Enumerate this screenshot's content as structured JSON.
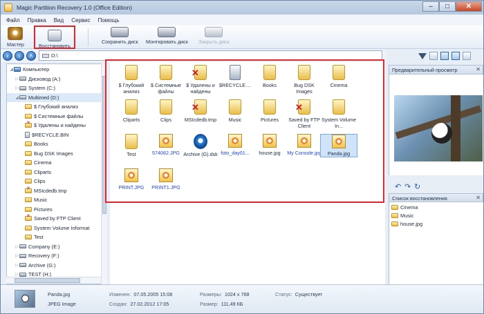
{
  "window": {
    "title": "Magic Partition Recovery 1.0 (Office Edition)"
  },
  "menu": [
    "Файл",
    "Правка",
    "Вид",
    "Сервис",
    "Помощь"
  ],
  "toolbar": {
    "master": "Мастер",
    "restore": "Восстановить",
    "save_disk": "Сохранить диск",
    "mount_disk": "Монтировать диск",
    "close_disk": "Закрыть диск"
  },
  "address": {
    "value": "D:\\"
  },
  "tree": [
    {
      "label": "Компьютер",
      "icon": "computer-icon",
      "depth": 0,
      "expanded": true
    },
    {
      "label": "Дисковод (A:)",
      "icon": "drive-icon",
      "depth": 1
    },
    {
      "label": "System (C:)",
      "icon": "drive-icon",
      "depth": 1
    },
    {
      "label": "Multimed (D:)",
      "icon": "drive-icon",
      "depth": 1,
      "selected": true,
      "expanded": true
    },
    {
      "label": "$ Глубокий анализ",
      "icon": "folder-icon",
      "depth": 2
    },
    {
      "label": "$ Системные файлы",
      "icon": "folder-icon",
      "depth": 2
    },
    {
      "label": "$ Удалены и найдены",
      "icon": "deleted-folder-icon",
      "depth": 2
    },
    {
      "label": "$RECYCLE.BIN",
      "icon": "recycle-bin-icon",
      "depth": 2
    },
    {
      "label": "Books",
      "icon": "folder-icon",
      "depth": 2
    },
    {
      "label": "Bug DSK Images",
      "icon": "folder-icon",
      "depth": 2
    },
    {
      "label": "Cinema",
      "icon": "folder-icon",
      "depth": 2
    },
    {
      "label": "Cliparts",
      "icon": "folder-icon",
      "depth": 2
    },
    {
      "label": "Clips",
      "icon": "folder-icon",
      "depth": 2
    },
    {
      "label": "MSIcdedb.tmp",
      "icon": "deleted-folder-icon",
      "depth": 2
    },
    {
      "label": "Music",
      "icon": "folder-icon",
      "depth": 2
    },
    {
      "label": "Pictures",
      "icon": "folder-icon",
      "depth": 2
    },
    {
      "label": "Saved by FTP Client",
      "icon": "deleted-folder-icon",
      "depth": 2
    },
    {
      "label": "System Volume Informat",
      "icon": "folder-icon",
      "depth": 2
    },
    {
      "label": "Test",
      "icon": "folder-icon",
      "depth": 2
    },
    {
      "label": "Company (E:)",
      "icon": "drive-icon",
      "depth": 1
    },
    {
      "label": "Recovery (F:)",
      "icon": "drive-icon",
      "depth": 1
    },
    {
      "label": "Archive (G:)",
      "icon": "drive-icon",
      "depth": 1
    },
    {
      "label": "TEST (H:)",
      "icon": "drive-icon",
      "depth": 1
    }
  ],
  "files": [
    {
      "name": "$ Глубокий анализ",
      "icon": "folder-icon"
    },
    {
      "name": "$ Системные файлы",
      "icon": "folder-icon"
    },
    {
      "name": "$ Удалены и найдены",
      "icon": "deleted-folder-icon"
    },
    {
      "name": "$RECYCLE....",
      "icon": "recycle-bin-icon"
    },
    {
      "name": "Books",
      "icon": "folder-icon"
    },
    {
      "name": "Bug DSK Images",
      "icon": "folder-icon"
    },
    {
      "name": "Cinema",
      "icon": "folder-icon"
    },
    {
      "name": "Cliparts",
      "icon": "folder-icon"
    },
    {
      "name": "Clips",
      "icon": "folder-icon"
    },
    {
      "name": "MSIcdedb.tmp",
      "icon": "deleted-folder-icon"
    },
    {
      "name": "Music",
      "icon": "folder-icon"
    },
    {
      "name": "Pictures",
      "icon": "folder-icon"
    },
    {
      "name": "Saved by FTP Client",
      "icon": "deleted-folder-icon"
    },
    {
      "name": "System Volume In...",
      "icon": "folder-icon"
    },
    {
      "name": "Test",
      "icon": "folder-icon"
    },
    {
      "name": "574062.JPG",
      "icon": "jpg-icon",
      "blue": true
    },
    {
      "name": "Archive (G).dsk",
      "icon": "disk-image-icon"
    },
    {
      "name": "foto_day01...",
      "icon": "jpg-icon",
      "blue": true
    },
    {
      "name": "house.jpg",
      "icon": "jpg-icon"
    },
    {
      "name": "My Console.jpg",
      "icon": "jpg-icon",
      "blue": true
    },
    {
      "name": "Panda.jpg",
      "icon": "jpg-icon",
      "selected": true
    },
    {
      "name": "PRINT.JPG",
      "icon": "jpg-icon",
      "blue": true
    },
    {
      "name": "PRINT1.JPG",
      "icon": "jpg-icon",
      "blue": true
    }
  ],
  "preview": {
    "title": "Предварительный просмотр"
  },
  "recovery_list": {
    "title": "Список восстановления",
    "items": [
      {
        "name": "Cinema",
        "icon": "folder-icon"
      },
      {
        "name": "Music",
        "icon": "folder-icon"
      },
      {
        "name": "house.jpg",
        "icon": "jpg-icon"
      }
    ]
  },
  "status": {
    "filename": "Panda.jpg",
    "type": "JPEG Image",
    "modified_label": "Изменен:",
    "modified": "07.05.2005 15:08",
    "created_label": "Создан:",
    "created": "27.02.2012 17:05",
    "dimensions_label": "Размеры:",
    "dimensions": "1024 x 768",
    "size_label": "Размер:",
    "size": "111,49 КБ",
    "state_label": "Статус:",
    "state": "Существует"
  }
}
